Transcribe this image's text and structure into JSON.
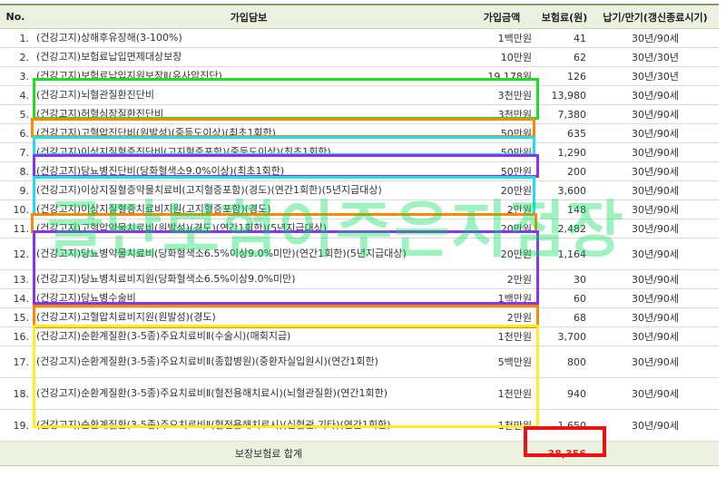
{
  "headers": {
    "no": "No.",
    "coverage": "가입담보",
    "amount": "가입금액",
    "premium": "보험료(원)",
    "term": "납기/만기(갱신종료시기)"
  },
  "rows": [
    {
      "no": "1.",
      "coverage": "(건강고지)상해후유장해(3-100%)",
      "amount": "1백만원",
      "premium": "41",
      "term": "30년/90세"
    },
    {
      "no": "2.",
      "coverage": "(건강고지)보험료납입면제대상보장",
      "amount": "10만원",
      "premium": "62",
      "term": "30년/30년"
    },
    {
      "no": "3.",
      "coverage": "(건강고지)보험료납입지원보장Ⅱ(유사암진단)",
      "amount": "19,178원",
      "premium": "126",
      "term": "30년/30년"
    },
    {
      "no": "4.",
      "coverage": "(건강고지)뇌혈관질환진단비",
      "amount": "3천만원",
      "premium": "13,980",
      "term": "30년/90세"
    },
    {
      "no": "5.",
      "coverage": "(건강고지)허혈심장질환진단비",
      "amount": "3천만원",
      "premium": "7,380",
      "term": "30년/90세"
    },
    {
      "no": "6.",
      "coverage": "(건강고지)고혈압진단비(원발성)(중등도이상)(최초1회한)",
      "amount": "50만원",
      "premium": "635",
      "term": "30년/90세"
    },
    {
      "no": "7.",
      "coverage": "(건강고지)이상지질혈증진단비(고지혈증포함)(중등도이상)(최초1회한)",
      "amount": "50만원",
      "premium": "1,290",
      "term": "30년/90세"
    },
    {
      "no": "8.",
      "coverage": "(건강고지)당뇨병진단비(당화혈색소9.0%이상)(최초1회한)",
      "amount": "50만원",
      "premium": "200",
      "term": "30년/90세"
    },
    {
      "no": "9.",
      "coverage": "(건강고지)이상지질혈증약물치료비(고지혈증포함)(경도)(연간1회한)(5년지급대상)",
      "amount": "20만원",
      "premium": "3,600",
      "term": "30년/90세"
    },
    {
      "no": "10.",
      "coverage": "(건강고지)이상지질혈증치료비지원(고지혈증포함)(경도)",
      "amount": "2만원",
      "premium": "148",
      "term": "30년/90세"
    },
    {
      "no": "11.",
      "coverage": "(건강고지)고혈압약물치료비(원발성)(경도)(연간1회한)(5년지급대상)",
      "amount": "20만원",
      "premium": "2,482",
      "term": "30년/90세"
    },
    {
      "no": "12.",
      "coverage": "(건강고지)당뇨병약물치료비(당화혈색소6.5%이상9.0%미만)(연간1회한)(5년지급대상)",
      "amount": "20만원",
      "premium": "1,164",
      "term": "30년/90세"
    },
    {
      "no": "13.",
      "coverage": "(건강고지)당뇨병치료비지원(당화혈색소6.5%이상9.0%미만)",
      "amount": "2만원",
      "premium": "30",
      "term": "30년/90세"
    },
    {
      "no": "14.",
      "coverage": "(건강고지)당뇨병수술비",
      "amount": "1백만원",
      "premium": "60",
      "term": "30년/90세"
    },
    {
      "no": "15.",
      "coverage": "(건강고지)고혈압치료비지원(원발성)(경도)",
      "amount": "2만원",
      "premium": "68",
      "term": "30년/90세"
    },
    {
      "no": "16.",
      "coverage": "(건강고지)순환계질환(3-5종)주요치료비Ⅱ(수술시)(매회지급)",
      "amount": "1천만원",
      "premium": "3,700",
      "term": "30년/90세"
    },
    {
      "no": "17.",
      "coverage": "(건강고지)순환계질환(3-5종)주요치료비Ⅱ(종합병원)(중환자실입원시)(연간1회한)",
      "amount": "5백만원",
      "premium": "800",
      "term": "30년/90세"
    },
    {
      "no": "18.",
      "coverage": "(건강고지)순환계질환(3-5종)주요치료비Ⅱ(혈전용해치료시)(뇌혈관질환)(연간1회한)",
      "amount": "1천만원",
      "premium": "940",
      "term": "30년/90세"
    },
    {
      "no": "19.",
      "coverage": "(건강고지)순환계질환(3-5종)주요치료비Ⅱ(혈전용해치료시)(심혈관,기타)(연간1회한)",
      "amount": "1천만원",
      "premium": "1,650",
      "term": "30년/90세"
    }
  ],
  "total": {
    "label": "보장보험료 합계",
    "premium": "38,356"
  },
  "watermark": "굴단보험이주은지점장",
  "colors": {
    "green": "#22dd22",
    "orange": "#ff8800",
    "cyan": "#22ddee",
    "purple": "#8833ee",
    "yellow": "#ffee22",
    "red": "#ee1111",
    "header_bg": "#ecf1df"
  }
}
